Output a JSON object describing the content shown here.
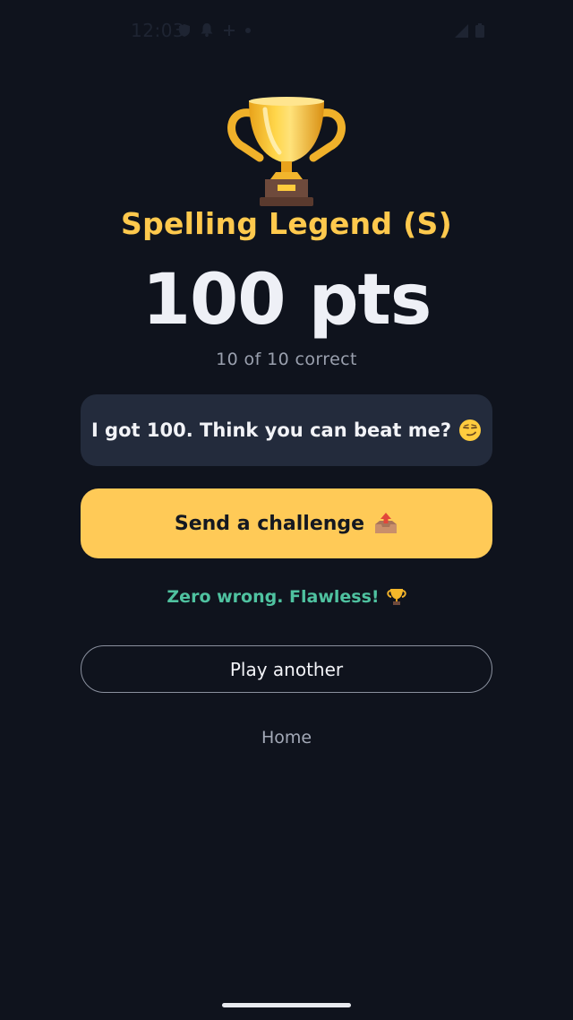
{
  "status_bar": {
    "time": "12:03",
    "icons_left": [
      "shield-icon",
      "bell-icon",
      "plus-icon",
      "dot-icon"
    ],
    "icons_right": [
      "signal-icon",
      "battery-icon"
    ]
  },
  "result": {
    "trophy_icon": "trophy-icon",
    "title": "Spelling Legend (S)",
    "score": "100 pts",
    "correct": "10 of 10 correct"
  },
  "message": {
    "text": "I got 100. Think you can beat me?",
    "emoji_icon": "smirk-face-icon"
  },
  "actions": {
    "challenge_label": "Send a challenge",
    "challenge_icon": "outbox-tray-icon",
    "flawless_text": "Zero wrong. Flawless!",
    "flawless_icon": "trophy-icon",
    "play_another_label": "Play another",
    "home_label": "Home"
  },
  "colors": {
    "background": "#0f131d",
    "accent_gold": "#ffc94d",
    "button_gold": "#ffca57",
    "card": "#232b3c",
    "success_green": "#4fc2a0"
  }
}
